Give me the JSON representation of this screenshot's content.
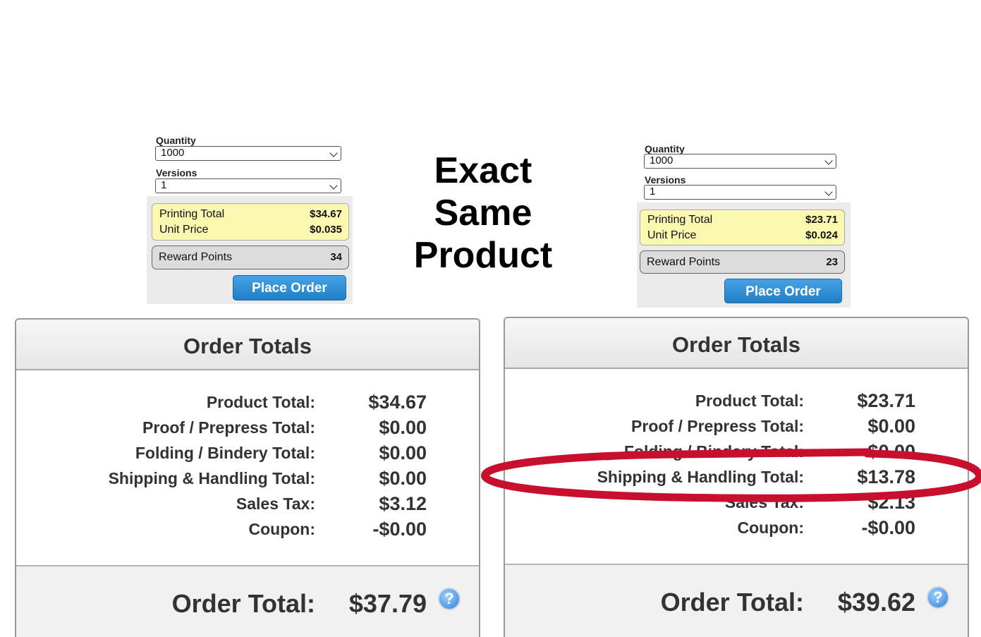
{
  "headline": [
    "Exact",
    "Same",
    "Product"
  ],
  "left": {
    "quantity_label": "Quantity",
    "quantity_value": "1000",
    "versions_label": "Versions",
    "versions_value": "1",
    "printing_total_label": "Printing Total",
    "printing_total_value": "$34.67",
    "unit_price_label": "Unit Price",
    "unit_price_value": "$0.035",
    "reward_points_label": "Reward Points",
    "reward_points_value": "34",
    "place_order_label": "Place Order",
    "totals": {
      "title": "Order Totals",
      "lines": [
        {
          "label": "Product Total:",
          "value": "$34.67"
        },
        {
          "label": "Proof / Prepress Total:",
          "value": "$0.00"
        },
        {
          "label": "Folding / Bindery Total:",
          "value": "$0.00"
        },
        {
          "label": "Shipping & Handling Total:",
          "value": "$0.00"
        },
        {
          "label": "Sales Tax:",
          "value": "$3.12"
        },
        {
          "label": "Coupon:",
          "value": "-$0.00"
        }
      ],
      "order_total_label": "Order Total:",
      "order_total_value": "$37.79",
      "help_glyph": "?"
    }
  },
  "right": {
    "quantity_label": "Quantity",
    "quantity_value": "1000",
    "versions_label": "Versions",
    "versions_value": "1",
    "printing_total_label": "Printing Total",
    "printing_total_value": "$23.71",
    "unit_price_label": "Unit Price",
    "unit_price_value": "$0.024",
    "reward_points_label": "Reward Points",
    "reward_points_value": "23",
    "place_order_label": "Place Order",
    "totals": {
      "title": "Order Totals",
      "lines": [
        {
          "label": "Product Total:",
          "value": "$23.71"
        },
        {
          "label": "Proof / Prepress Total:",
          "value": "$0.00"
        },
        {
          "label": "Folding / Bindery Total:",
          "value": "$0.00"
        },
        {
          "label": "Shipping & Handling Total:",
          "value": "$13.78"
        },
        {
          "label": "Sales Tax:",
          "value": "$2.13"
        },
        {
          "label": "Coupon:",
          "value": "-$0.00"
        }
      ],
      "order_total_label": "Order Total:",
      "order_total_value": "$39.62",
      "help_glyph": "?"
    }
  },
  "colors": {
    "highlight_oval": "#c8102e",
    "price_box": "#fbf8b0",
    "button": "#1f7fc6"
  }
}
